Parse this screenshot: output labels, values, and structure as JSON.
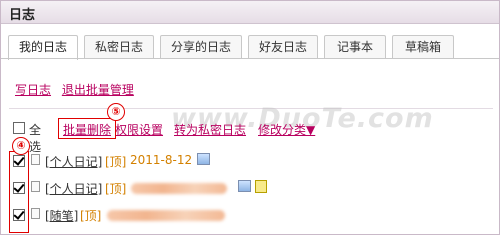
{
  "window": {
    "title": "日志"
  },
  "tabs": [
    {
      "label": "我的日志",
      "active": true
    },
    {
      "label": "私密日志"
    },
    {
      "label": "分享的日志"
    },
    {
      "label": "好友日志"
    },
    {
      "label": "记事本"
    },
    {
      "label": "草稿箱"
    }
  ],
  "actions": {
    "write": "写日志",
    "exit_batch": "退出批量管理"
  },
  "toolbar": {
    "select_all": "全选",
    "batch_delete": "批量删除",
    "permissions": "权限设置",
    "to_private": "转为私密日志",
    "change_category": "修改分类▼"
  },
  "annotations": {
    "step5": "⑤",
    "step4": "④"
  },
  "watermark": "www.DuoTe.com",
  "entries": [
    {
      "category": "[个人日记]",
      "top": "[顶]",
      "date": "2011-8-12",
      "checked": true
    },
    {
      "category": "[个人日记]",
      "top": "[顶]",
      "checked": true
    },
    {
      "category": "[随笔]",
      "top": "[顶]",
      "checked": true
    }
  ],
  "colors": {
    "link": "#b8005f",
    "annotation": "#e00000",
    "top": "#d38000"
  }
}
